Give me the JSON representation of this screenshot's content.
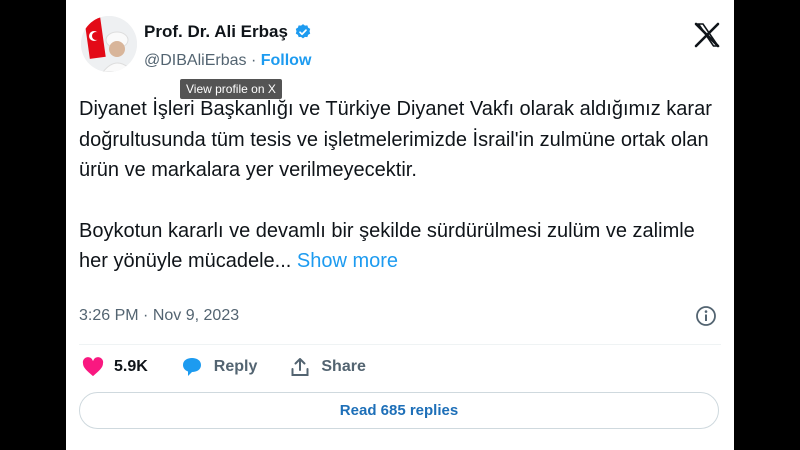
{
  "author": {
    "name": "Prof. Dr. Ali Erbaş",
    "handle": "@DIBAliErbas",
    "separator": "·",
    "follow_label": "Follow",
    "verified": true
  },
  "tooltip": "View profile on X",
  "tweet": {
    "paragraph1": "Diyanet İşleri Başkanlığı ve Türkiye Diyanet Vakfı olarak aldığımız karar doğrultusunda tüm tesis ve işletmelerimizde İsrail'in zulmüne ortak olan ürün ve markalara yer verilmeyecektir.",
    "paragraph2": "Boykotun kararlı ve devamlı bir şekilde sürdürülmesi zulüm ve zalimle her yönüyle mücadele...",
    "show_more_label": "Show more"
  },
  "meta": {
    "time": "3:26 PM",
    "separator": "·",
    "date": "Nov 9, 2023"
  },
  "actions": {
    "likes_count": "5.9K",
    "reply_label": "Reply",
    "share_label": "Share"
  },
  "replies_button_label": "Read 685 replies",
  "icons": {
    "like": "heart-icon",
    "reply": "speech-bubble-icon",
    "share": "share-icon",
    "info": "info-icon",
    "logo": "x-logo-icon",
    "verified": "verified-badge-icon"
  },
  "colors": {
    "accent": "#1d9bf0",
    "like": "#f91880",
    "text": "#0f1419",
    "secondary": "#536471"
  }
}
